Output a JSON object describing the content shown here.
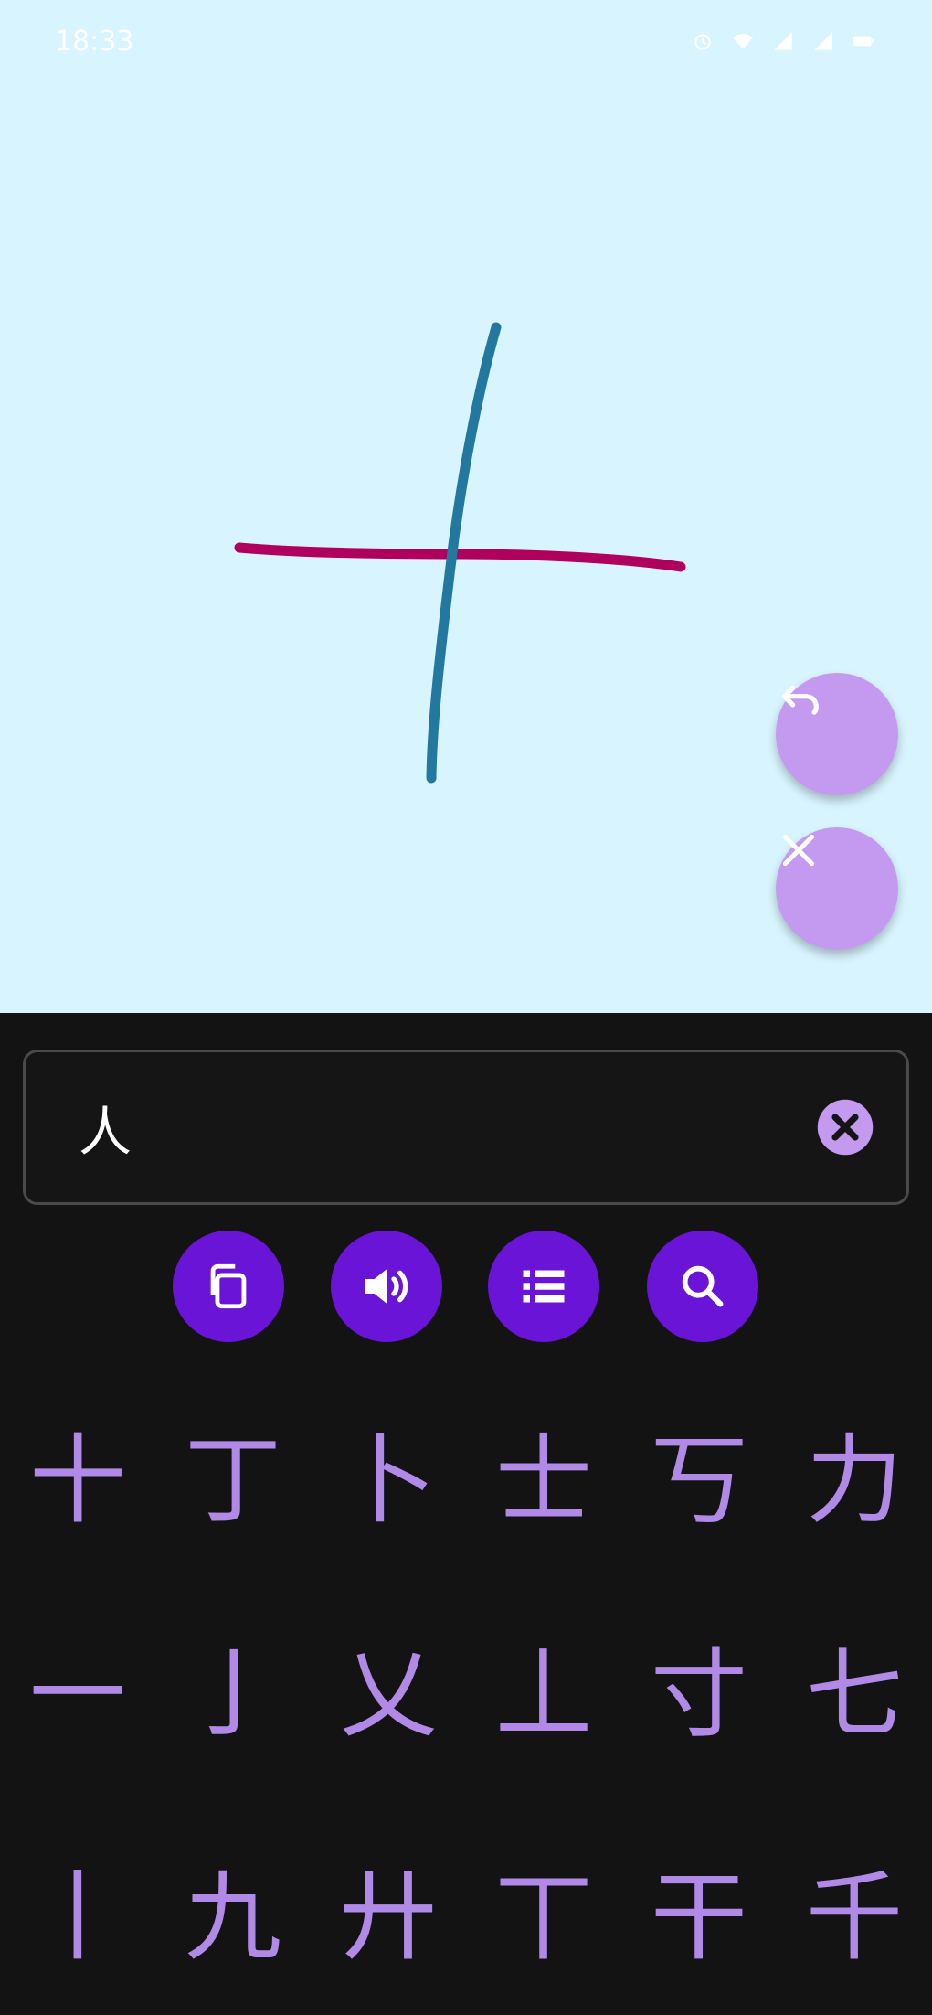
{
  "status_bar": {
    "time": "18:33",
    "icons": [
      "alarm-icon",
      "wifi-icon",
      "signal-icon",
      "signal-icon",
      "battery-icon"
    ]
  },
  "canvas": {
    "background": "#d8f4fe",
    "strokes": [
      {
        "name": "horizontal-stroke",
        "color": "#b0005e"
      },
      {
        "name": "vertical-stroke",
        "color": "#2378a0"
      }
    ],
    "buttons": [
      {
        "icon": "undo-icon",
        "color": "#c49af1"
      },
      {
        "icon": "close-icon",
        "color": "#c49af1"
      }
    ]
  },
  "search": {
    "value": "人",
    "clear_icon": "clear-circle-icon"
  },
  "actions": [
    {
      "icon": "copy-icon"
    },
    {
      "icon": "speaker-icon"
    },
    {
      "icon": "list-icon"
    },
    {
      "icon": "search-icon"
    }
  ],
  "candidates": [
    [
      "十",
      "丁",
      "卜",
      "士",
      "丂",
      "力"
    ],
    [
      "一",
      "亅",
      "乂",
      "丄",
      "寸",
      "七"
    ],
    [
      "丨",
      "九",
      "廾",
      "丅",
      "干",
      "千"
    ]
  ],
  "colors": {
    "accent": "#6a14d8",
    "candidate_text": "#b08ae6",
    "fab": "#c49af1",
    "panel_bg": "#131313"
  }
}
